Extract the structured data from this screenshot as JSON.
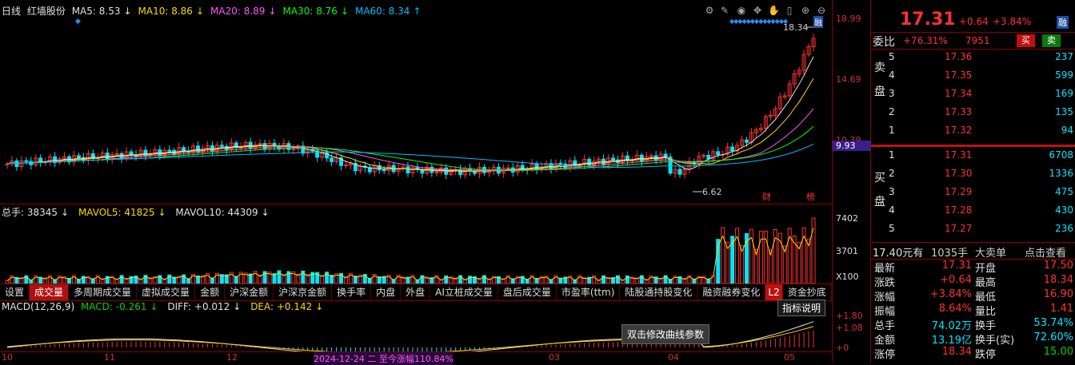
{
  "main": {
    "label": "日线",
    "stock_name": "红墙股份",
    "ma": [
      {
        "name": "MA5: 8.53",
        "arrow": "↓",
        "color": "#e0e0e0"
      },
      {
        "name": "MA10: 8.86",
        "arrow": "↓",
        "color": "#ffd700"
      },
      {
        "name": "MA20: 8.89",
        "arrow": "↓",
        "color": "#ff55ff"
      },
      {
        "name": "MA30: 8.76",
        "arrow": "↓",
        "color": "#00ff00"
      },
      {
        "name": "MA60: 8.34",
        "arrow": "↑",
        "color": "#00bfff"
      }
    ],
    "high_label": "18.34",
    "low_label": "6.62",
    "marker_cai": "财",
    "marker_bang": "榜",
    "price_axis": [
      "18.99",
      "14.69",
      "10.39",
      "9.93"
    ]
  },
  "volume": {
    "label_total": "总手: 38345",
    "label_mavol5": "MAVOL5: 41825",
    "label_mavol10": "MAVOL10: 44309",
    "arrow_down": "↓",
    "axis": [
      "7402",
      "3701",
      "X100"
    ]
  },
  "tabs": [
    "设置",
    "成交量",
    "多周期成交量",
    "虚拟成交量",
    "金额",
    "沪深金额",
    "沪深京金额",
    "换手率",
    "内盘",
    "外盘",
    "AI立桩成交量",
    "盘后成交量",
    "市盈率(ttm)",
    "陆股通持股变化",
    "融资融券变化",
    "资金抄底"
  ],
  "tab_badge": "L2",
  "macd": {
    "label": "MACD(12,26,9)",
    "macd_val": "MACD: -0.261",
    "diff": "DIFF: +0.012",
    "dea": "DEA: +0.142",
    "arrow_down": "↓",
    "axis": [
      "+1.80",
      "+1.08",
      "+0"
    ],
    "help_btn": "指标说明",
    "tooltip": "双击修改曲线参数"
  },
  "date_axis": [
    "10",
    "11",
    "12",
    "2024-12-24 二 至今涨幅110.84%",
    "03",
    "04",
    "05"
  ],
  "quote": {
    "price": "17.31",
    "change": "+0.64",
    "pct": "+3.84%",
    "badge": "融",
    "weibi_label": "委比",
    "weibi_val": "+76.31%",
    "weibi_num": "7951",
    "buy_btn": "买",
    "sell_btn": "卖",
    "sell_side_label": "卖盘",
    "buy_side_label": "买盘",
    "asks": [
      {
        "lvl": "5",
        "price": "17.36",
        "vol": "237"
      },
      {
        "lvl": "4",
        "price": "17.35",
        "vol": "599"
      },
      {
        "lvl": "3",
        "price": "17.34",
        "vol": "169"
      },
      {
        "lvl": "2",
        "price": "17.33",
        "vol": "135"
      },
      {
        "lvl": "1",
        "price": "17.32",
        "vol": "94"
      }
    ],
    "bids": [
      {
        "lvl": "1",
        "price": "17.31",
        "vol": "6708"
      },
      {
        "lvl": "2",
        "price": "17.30",
        "vol": "1336"
      },
      {
        "lvl": "3",
        "price": "17.29",
        "vol": "475"
      },
      {
        "lvl": "4",
        "price": "17.28",
        "vol": "430"
      },
      {
        "lvl": "5",
        "price": "17.27",
        "vol": "236"
      }
    ],
    "big_order": "17.40元有",
    "big_order_vol": "1035手",
    "big_order_type": "大卖单",
    "big_order_link": "点击查看",
    "stats": [
      {
        "l": "最新",
        "lv": "17.31",
        "lc": "red",
        "r": "开盘",
        "rv": "17.50",
        "rc": "red"
      },
      {
        "l": "涨跌",
        "lv": "+0.64",
        "lc": "red",
        "r": "最高",
        "rv": "18.34",
        "rc": "red"
      },
      {
        "l": "涨幅",
        "lv": "+3.84%",
        "lc": "red",
        "r": "最低",
        "rv": "16.90",
        "rc": "red"
      },
      {
        "l": "振幅",
        "lv": "8.64%",
        "lc": "red",
        "r": "量比",
        "rv": "1.41",
        "rc": "red"
      },
      {
        "l": "总手",
        "lv": "74.02万",
        "lc": "cyan",
        "r": "换手",
        "rv": "53.74%",
        "rc": "cyan"
      },
      {
        "l": "金额",
        "lv": "13.19亿",
        "lc": "cyan",
        "r": "换手(实)",
        "rv": "72.60%",
        "rc": "cyan"
      },
      {
        "l": "涨停",
        "lv": "18.34",
        "lc": "red",
        "r": "跌停",
        "rv": "15.00",
        "rc": "green"
      }
    ]
  },
  "colors": {
    "up": "#ff3030",
    "down": "#00e5ff",
    "border": "#8b0000"
  }
}
